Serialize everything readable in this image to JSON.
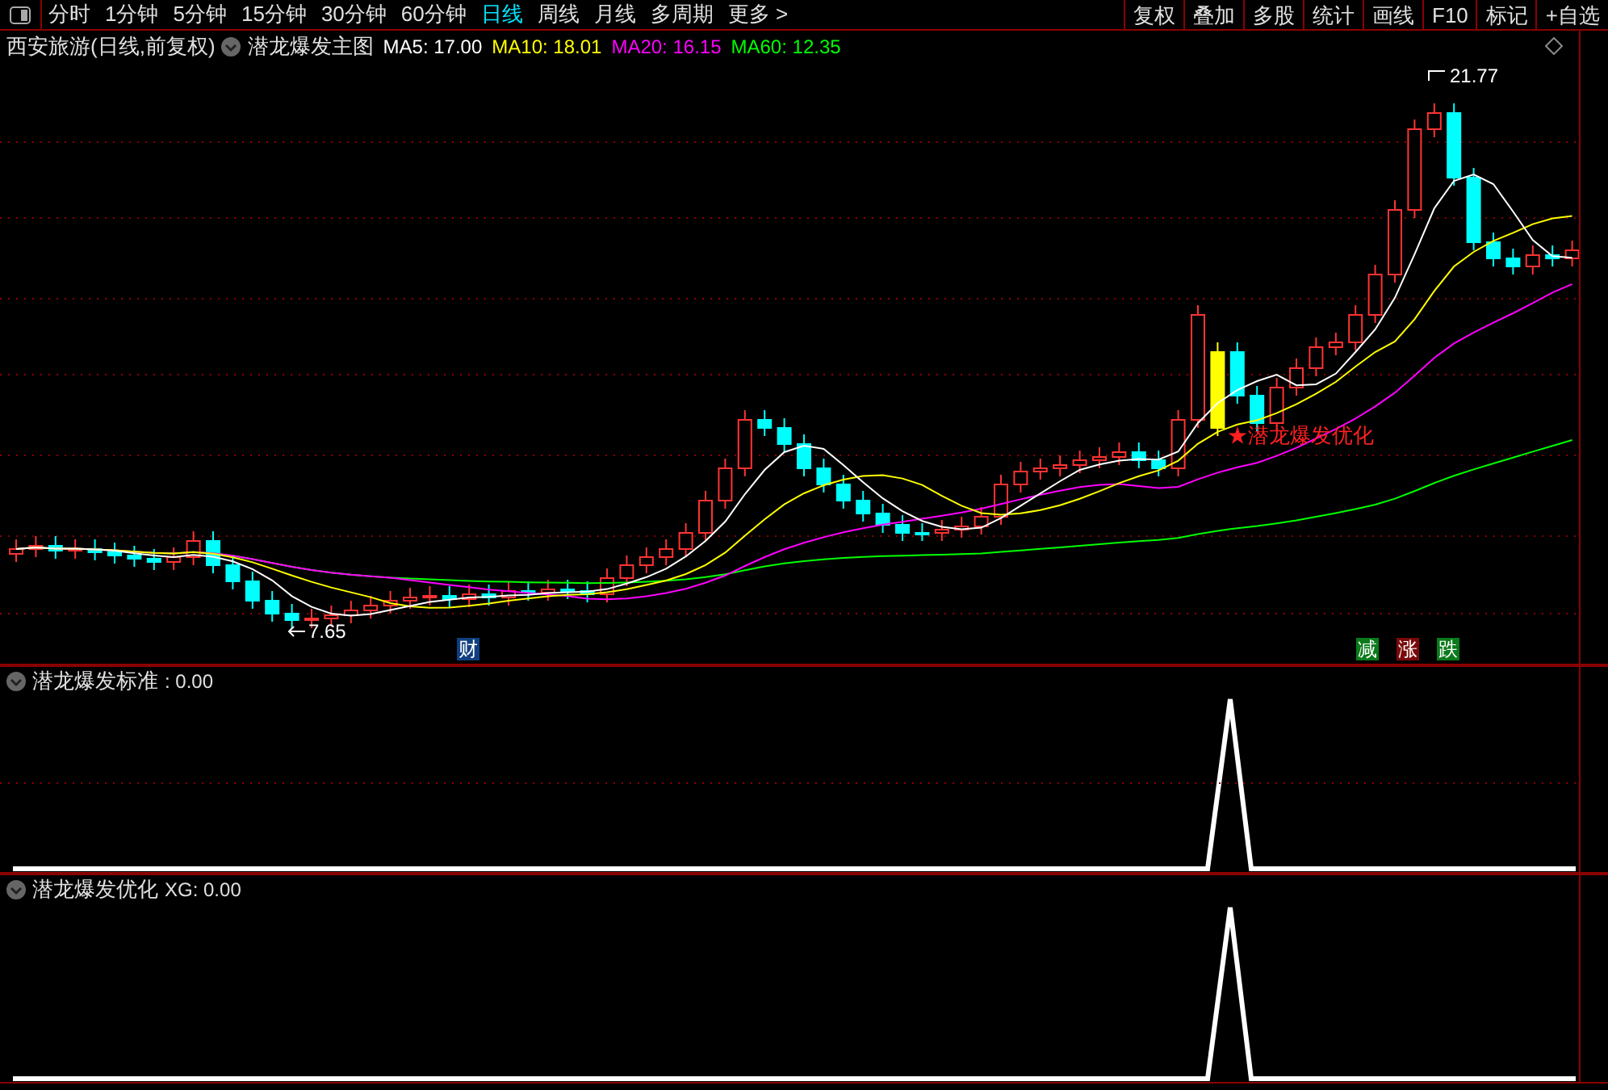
{
  "toolbar": {
    "periods": [
      {
        "label": "分时",
        "selected": false
      },
      {
        "label": "1分钟",
        "selected": false
      },
      {
        "label": "5分钟",
        "selected": false
      },
      {
        "label": "15分钟",
        "selected": false
      },
      {
        "label": "30分钟",
        "selected": false
      },
      {
        "label": "60分钟",
        "selected": false
      },
      {
        "label": "日线",
        "selected": true
      },
      {
        "label": "周线",
        "selected": false
      },
      {
        "label": "月线",
        "selected": false
      },
      {
        "label": "多周期",
        "selected": false
      },
      {
        "label": "更多 >",
        "selected": false
      }
    ],
    "buttons": [
      "复权",
      "叠加",
      "多股",
      "统计",
      "画线",
      "F10",
      "标记",
      "+自选"
    ]
  },
  "info": {
    "stock": "西安旅游(日线,前复权)",
    "indicator": "潜龙爆发主图",
    "ma": [
      {
        "label": "MA5: 17.00",
        "color": "#ffffff"
      },
      {
        "label": "MA10: 18.01",
        "color": "#ffff00"
      },
      {
        "label": "MA20: 16.15",
        "color": "#ff00ff"
      },
      {
        "label": "MA60: 12.35",
        "color": "#00ff00"
      }
    ]
  },
  "main_chart": {
    "high_label": "21.77",
    "low_label": "7.65",
    "signal_label": "★潜龙爆发优化",
    "events": [
      {
        "text": "财",
        "color": "#0f3f80"
      },
      {
        "text": "减",
        "color": "#0a7a1a"
      },
      {
        "text": "涨",
        "color": "#7a0a0a"
      },
      {
        "text": "跌",
        "color": "#0a7a1a"
      }
    ]
  },
  "panels": [
    {
      "title": "潜龙爆发标准",
      "value": ": 0.00"
    },
    {
      "title": "潜龙爆发优化",
      "value": "XG: 0.00"
    }
  ]
}
